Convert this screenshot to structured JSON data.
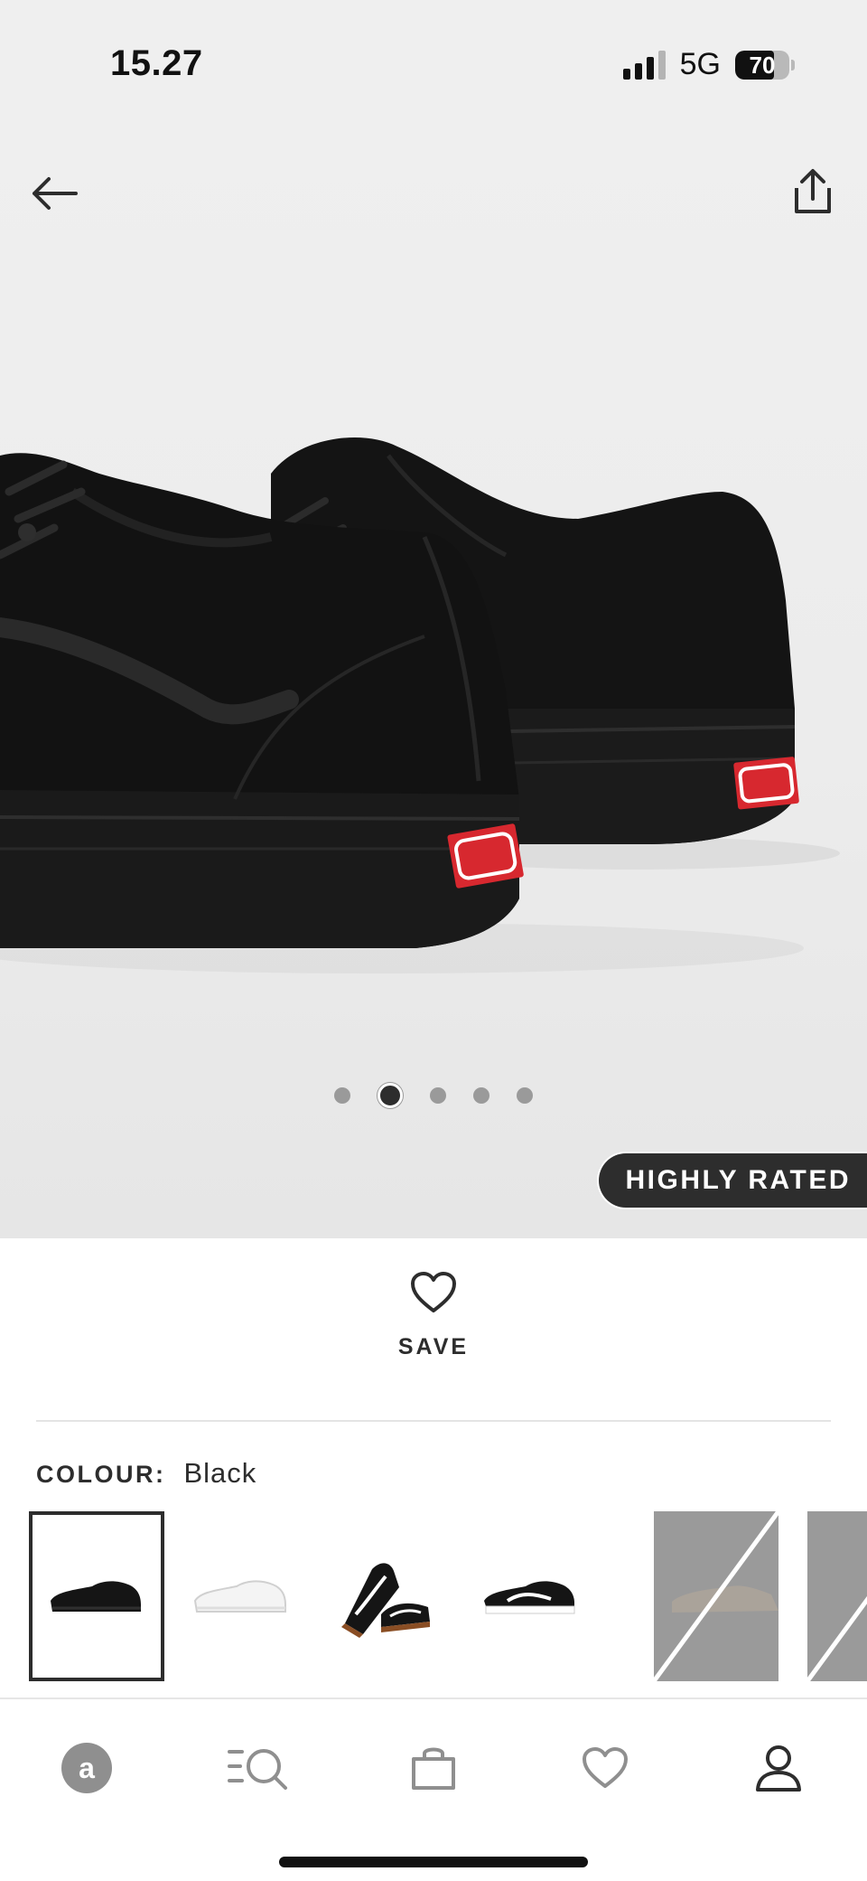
{
  "status_bar": {
    "time": "15.27",
    "network": "5G",
    "battery_percent": "70"
  },
  "product": {
    "image_alt": "Black canvas low-top sneakers, rear view",
    "carousel": {
      "count": 5,
      "active_index": 1
    },
    "badge": "HIGHLY RATED",
    "save_label": "SAVE",
    "colour_label": "COLOUR:",
    "colour_value": "Black",
    "swatches": [
      {
        "name": "Black",
        "state": "selected"
      },
      {
        "name": "White",
        "state": "available"
      },
      {
        "name": "Black/Gum",
        "state": "available"
      },
      {
        "name": "Black/White",
        "state": "available"
      },
      {
        "name": "Grey",
        "state": "unavailable"
      },
      {
        "name": "Grey",
        "state": "unavailable"
      }
    ]
  },
  "icons": {
    "back": "arrow-left-icon",
    "share": "share-icon",
    "save": "heart-outline-icon"
  },
  "bottom_nav": {
    "items": [
      "home",
      "search",
      "bag",
      "saved",
      "account"
    ]
  },
  "colors": {
    "primary_text": "#2d2d2d",
    "badge_bg": "#2d2d2d",
    "hero_bg": "#efefef",
    "unavailable_swatch": "#9a9a9a",
    "brand_red": "#d7282f"
  }
}
